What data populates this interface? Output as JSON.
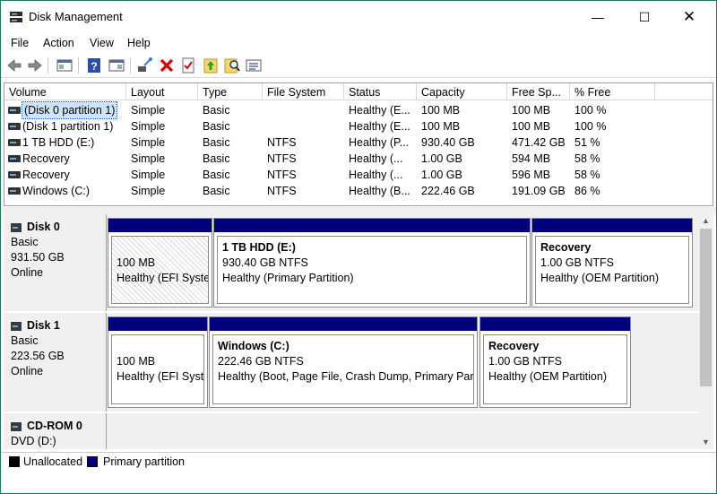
{
  "window": {
    "title": "Disk Management",
    "minimize": "—",
    "maximize": "☐",
    "close": "✕"
  },
  "menu": [
    "File",
    "Action",
    "View",
    "Help"
  ],
  "toolbar_icons": [
    "back-icon",
    "forward-icon",
    "console-tree-icon",
    "help-icon",
    "properties-icon",
    "connect-icon",
    "delete-icon",
    "check-icon",
    "rescan-icon",
    "search-icon",
    "details-icon"
  ],
  "columns": [
    "Volume",
    "Layout",
    "Type",
    "File System",
    "Status",
    "Capacity",
    "Free Sp...",
    "% Free"
  ],
  "volumes": [
    {
      "volume": "(Disk 0 partition 1)",
      "layout": "Simple",
      "type": "Basic",
      "fs": "",
      "status": "Healthy (E...",
      "capacity": "100 MB",
      "free": "100 MB",
      "pct": "100 %"
    },
    {
      "volume": "(Disk 1 partition 1)",
      "layout": "Simple",
      "type": "Basic",
      "fs": "",
      "status": "Healthy (E...",
      "capacity": "100 MB",
      "free": "100 MB",
      "pct": "100 %"
    },
    {
      "volume": "1 TB HDD (E:)",
      "layout": "Simple",
      "type": "Basic",
      "fs": "NTFS",
      "status": "Healthy (P...",
      "capacity": "930.40 GB",
      "free": "471.42 GB",
      "pct": "51 %"
    },
    {
      "volume": "Recovery",
      "layout": "Simple",
      "type": "Basic",
      "fs": "NTFS",
      "status": "Healthy (...",
      "capacity": "1.00 GB",
      "free": "594 MB",
      "pct": "58 %"
    },
    {
      "volume": "Recovery",
      "layout": "Simple",
      "type": "Basic",
      "fs": "NTFS",
      "status": "Healthy (...",
      "capacity": "1.00 GB",
      "free": "596 MB",
      "pct": "58 %"
    },
    {
      "volume": "Windows (C:)",
      "layout": "Simple",
      "type": "Basic",
      "fs": "NTFS",
      "status": "Healthy (B...",
      "capacity": "222.46 GB",
      "free": "191.09 GB",
      "pct": "86 %"
    }
  ],
  "disks": [
    {
      "name": "Disk 0",
      "type": "Basic",
      "size": "931.50 GB",
      "state": "Online",
      "partitions": [
        {
          "name": "",
          "size": "100 MB",
          "status": "Healthy (EFI System Partition)"
        },
        {
          "name": "1 TB HDD  (E:)",
          "size": "930.40 GB NTFS",
          "status": "Healthy (Primary Partition)"
        },
        {
          "name": "Recovery",
          "size": "1.00 GB NTFS",
          "status": "Healthy (OEM Partition)"
        }
      ]
    },
    {
      "name": "Disk 1",
      "type": "Basic",
      "size": "223.56 GB",
      "state": "Online",
      "partitions": [
        {
          "name": "",
          "size": "100 MB",
          "status": "Healthy (EFI System Partition)"
        },
        {
          "name": "Windows  (C:)",
          "size": "222.46 GB NTFS",
          "status": "Healthy (Boot, Page File, Crash Dump, Primary Partition)"
        },
        {
          "name": "Recovery",
          "size": "1.00 GB NTFS",
          "status": "Healthy (OEM Partition)"
        }
      ]
    },
    {
      "name": "CD-ROM 0",
      "type": "DVD (D:)"
    }
  ],
  "legend": [
    {
      "label": "Unallocated",
      "color": "#000000"
    },
    {
      "label": "Primary partition",
      "color": "#00007a"
    }
  ]
}
